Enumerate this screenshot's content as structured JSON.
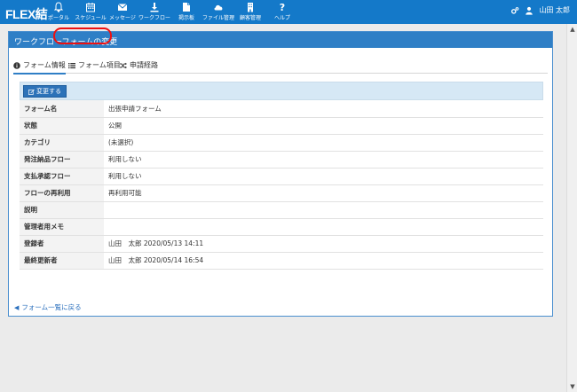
{
  "app": {
    "brand": "FLEX結"
  },
  "nav": {
    "items": [
      {
        "id": "portal",
        "label": "ポータル",
        "icon": "bell-icon"
      },
      {
        "id": "schedule",
        "label": "スケジュール",
        "icon": "calendar-icon"
      },
      {
        "id": "message",
        "label": "メッセージ",
        "icon": "envelope-icon"
      },
      {
        "id": "workflow",
        "label": "ワークフロー",
        "icon": "workflow-icon"
      },
      {
        "id": "board",
        "label": "掲示板",
        "icon": "bulletin-icon"
      },
      {
        "id": "files",
        "label": "ファイル管理",
        "icon": "cloud-icon"
      },
      {
        "id": "customers",
        "label": "顧客管理",
        "icon": "building-icon"
      },
      {
        "id": "help",
        "label": "ヘルプ",
        "icon": "question-icon"
      }
    ],
    "user_name": "山田 太郎",
    "settings_icon": "cogs-icon",
    "user_icon": "user-icon"
  },
  "panel": {
    "title": "ワークフローフォームの変更"
  },
  "tabs": [
    {
      "label": "フォーム情報",
      "icon": "info-circle-icon",
      "active": true
    },
    {
      "label": "フォーム項目",
      "icon": "list-icon",
      "active": false,
      "highlighted": true
    },
    {
      "label": "申請経路",
      "icon": "random-icon",
      "active": false
    }
  ],
  "actions": {
    "edit_label": "変更する",
    "edit_icon": "edit-icon"
  },
  "fields": [
    {
      "label": "フォーム名",
      "value": "出張申請フォーム"
    },
    {
      "label": "状態",
      "value": "公開"
    },
    {
      "label": "カテゴリ",
      "value": "(未選択)"
    },
    {
      "label": "発注納品フロー",
      "value": "利用しない"
    },
    {
      "label": "支払承認フロー",
      "value": "利用しない"
    },
    {
      "label": "フローの再利用",
      "value": "再利用可能"
    },
    {
      "label": "説明",
      "value": ""
    },
    {
      "label": "管理者用メモ",
      "value": ""
    },
    {
      "label": "登録者",
      "value": "山田　太郎 2020/05/13 14:11"
    },
    {
      "label": "最終更新者",
      "value": "山田　太郎 2020/05/14 16:54"
    }
  ],
  "back_link": {
    "label": "フォーム一覧に戻る"
  },
  "colors": {
    "navbar": "#1479c9",
    "panel_header": "#2f7fc6",
    "highlight": "#e11111",
    "action_bar": "#d6e8f5"
  }
}
